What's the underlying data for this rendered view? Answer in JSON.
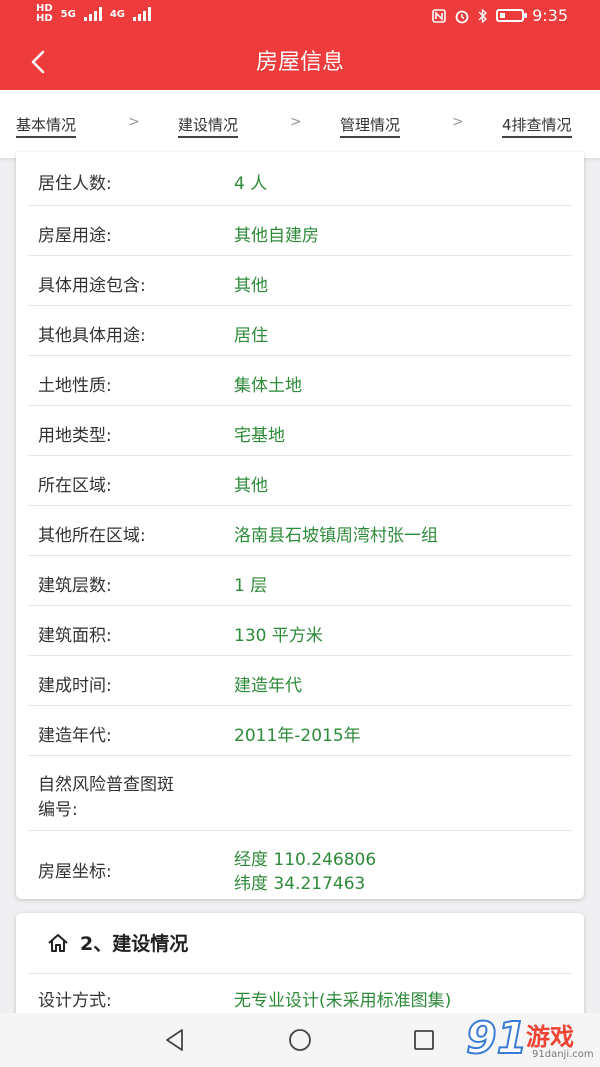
{
  "status": {
    "net1": "HD",
    "net2": "HD",
    "sig1": "5G",
    "sig2": "4G",
    "time": "9:35"
  },
  "header": {
    "title": "房屋信息"
  },
  "steps": [
    {
      "label": "基本情况"
    },
    {
      "label": "建设情况"
    },
    {
      "label": "管理情况"
    },
    {
      "label": "4排查情况"
    }
  ],
  "separator": ">",
  "basic_rows": [
    {
      "label": "居住人数:",
      "value": "4 人"
    },
    {
      "label": "房屋用途:",
      "value": "其他自建房"
    },
    {
      "label": "具体用途包含:",
      "value": "其他"
    },
    {
      "label": "其他具体用途:",
      "value": "居住"
    },
    {
      "label": "土地性质:",
      "value": "集体土地"
    },
    {
      "label": "用地类型:",
      "value": "宅基地"
    },
    {
      "label": "所在区域:",
      "value": "其他"
    },
    {
      "label": "其他所在区域:",
      "value": "洛南县石坡镇周湾村张一组"
    },
    {
      "label": "建筑层数:",
      "value": "1 层"
    },
    {
      "label": "建筑面积:",
      "value": "130 平方米"
    },
    {
      "label": "建成时间:",
      "value": "建造年代"
    },
    {
      "label": "建造年代:",
      "value": "2011年-2015年"
    },
    {
      "label": "自然风险普查图斑",
      "label2": "编号:",
      "value": ""
    },
    {
      "label": "房屋坐标:",
      "value": "经度 110.246806",
      "value2": "纬度 34.217463"
    }
  ],
  "section2": {
    "title": "2、建设情况",
    "rows": [
      {
        "label": "设计方式:",
        "value": "无专业设计(未采用标准图集)"
      }
    ]
  },
  "watermark": {
    "big": "91",
    "cn": "游戏",
    "url": "91danji.com"
  },
  "colors": {
    "primary": "#ee3b3b",
    "value_text": "#2e8b3a"
  }
}
